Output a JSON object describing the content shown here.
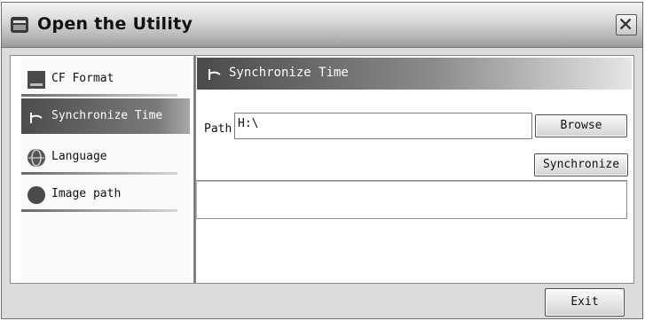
{
  "window": {
    "title": "Open the Utility"
  },
  "sidebar": {
    "items": [
      {
        "label": "CF Format",
        "icon": "cf-card-icon",
        "selected": false
      },
      {
        "label": "Synchronize Time",
        "icon": "sync-icon",
        "selected": true
      },
      {
        "label": "Language",
        "icon": "globe-icon",
        "selected": false
      },
      {
        "label": "Image path",
        "icon": "circle-icon",
        "selected": false
      }
    ]
  },
  "content": {
    "header_title": "Synchronize Time",
    "path_label": "Path",
    "path_value": "H:\\",
    "browse_label": "Browse",
    "synchronize_label": "Synchronize",
    "status_text": ""
  },
  "footer": {
    "exit_label": "Exit"
  },
  "colors": {
    "selected_nav_start": "#4c4c4c",
    "header_gradient_start": "#4a4a4a",
    "window_background": "#dcdcdc"
  }
}
